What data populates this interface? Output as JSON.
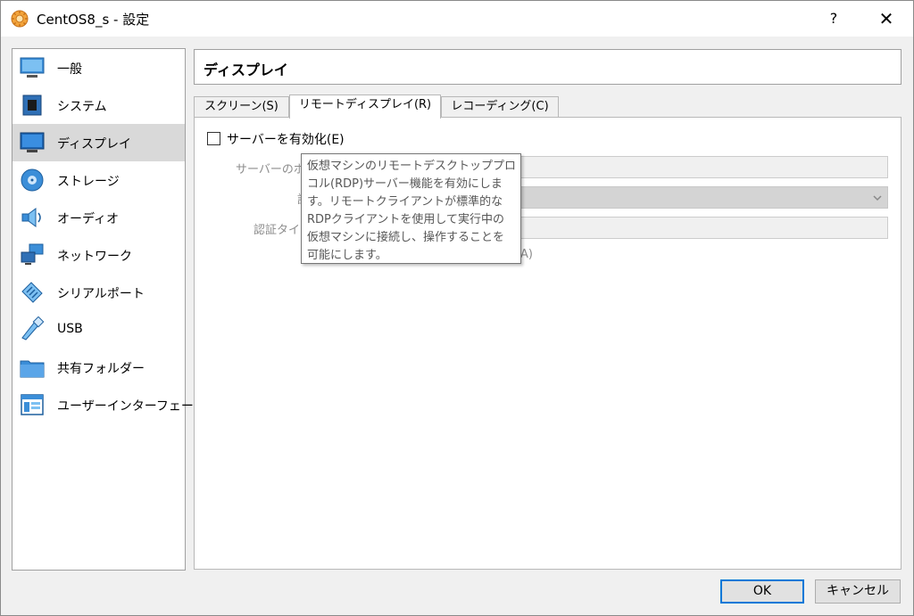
{
  "window": {
    "title": "CentOS8_s - 設定",
    "help": "?",
    "close": "✕"
  },
  "sidebar": {
    "items": [
      {
        "label": "一般",
        "icon": "monitor-icon"
      },
      {
        "label": "システム",
        "icon": "chip-icon"
      },
      {
        "label": "ディスプレイ",
        "icon": "display-icon",
        "selected": true
      },
      {
        "label": "ストレージ",
        "icon": "disk-icon"
      },
      {
        "label": "オーディオ",
        "icon": "speaker-icon"
      },
      {
        "label": "ネットワーク",
        "icon": "network-icon"
      },
      {
        "label": "シリアルポート",
        "icon": "serial-port-icon"
      },
      {
        "label": "USB",
        "icon": "usb-icon"
      },
      {
        "label": "共有フォルダー",
        "icon": "folder-icon"
      },
      {
        "label": "ユーザーインターフェース",
        "icon": "ui-window-icon"
      }
    ]
  },
  "header": {
    "title": "ディスプレイ"
  },
  "tabs": [
    {
      "label": "スクリーン(S)"
    },
    {
      "label": "リモートディスプレイ(R)",
      "active": true
    },
    {
      "label": "レコーディング(C)"
    }
  ],
  "remote": {
    "enable_label": "サーバーを有効化(E)",
    "enable_checked": false,
    "port_label": "サーバーのポ",
    "auth_method_label": "認",
    "auth_timeout_label": "認証タイ",
    "extended_label_tail": "A)"
  },
  "tooltip": {
    "lines": [
      "仮想マシンのリモートデスクトッププロト",
      "コル(RDP)サーバー機能を有効にしま",
      "す。リモートクライアントが標準的な",
      "RDPクライアントを使用して実行中の",
      "仮想マシンに接続し、操作することを",
      "可能にします。"
    ]
  },
  "buttons": {
    "ok": "OK",
    "cancel": "キャンセル"
  },
  "colors": {
    "accent": "#0078d7",
    "selected_bg": "#d9d9d9"
  }
}
